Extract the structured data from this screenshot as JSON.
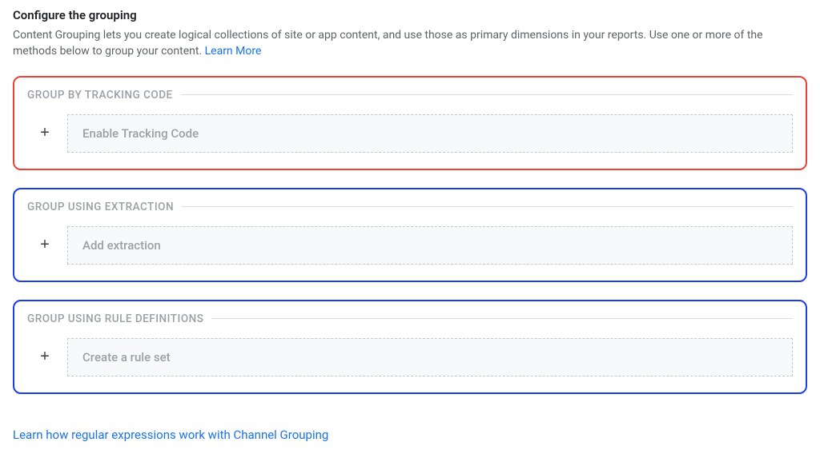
{
  "header": {
    "title": "Configure the grouping",
    "description_pre": "Content Grouping lets you create logical collections of site or app content, and use those as primary dimensions in your reports. Use one or more of the methods below to group your content. ",
    "learn_more": "Learn More"
  },
  "groups": [
    {
      "label": "GROUP BY TRACKING CODE",
      "button_label": "Enable Tracking Code",
      "highlight": "red"
    },
    {
      "label": "GROUP USING EXTRACTION",
      "button_label": "Add extraction",
      "highlight": "blue"
    },
    {
      "label": "GROUP USING RULE DEFINITIONS",
      "button_label": "Create a rule set",
      "highlight": "blue"
    }
  ],
  "footer": {
    "regex_link": "Learn how regular expressions work with Channel Grouping"
  },
  "icons": {
    "plus": "+"
  }
}
